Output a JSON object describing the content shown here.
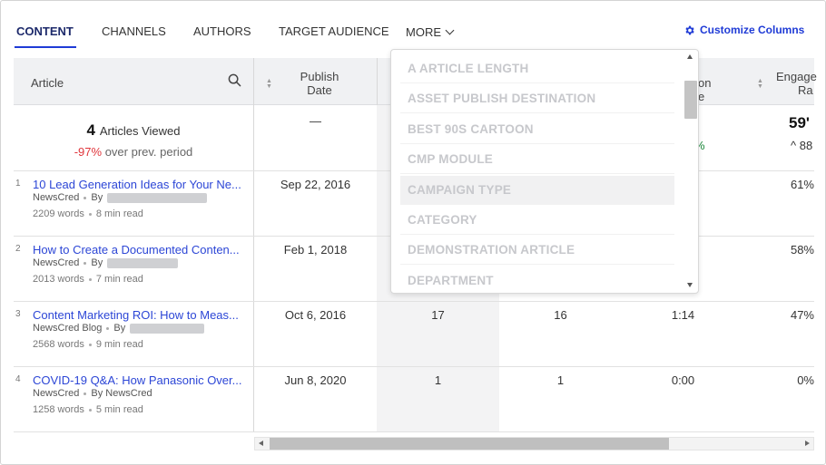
{
  "tabs": [
    {
      "label": "CONTENT"
    },
    {
      "label": "CHANNELS"
    },
    {
      "label": "AUTHORS"
    },
    {
      "label": "TARGET AUDIENCE"
    },
    {
      "label": "MORE"
    }
  ],
  "customize_label": "Customize Columns",
  "columns": {
    "article": "Article",
    "publish_line1": "Publish",
    "publish_line2": "Date",
    "duration_partial_1": "on",
    "duration_partial_2": "e",
    "engage_partial_1": "Engage",
    "engage_partial_2": "Ra"
  },
  "summary": {
    "count": "4",
    "label": "Articles Viewed",
    "change": "-97%",
    "change_suffix": "over prev. period",
    "publish_dash": "—",
    "duration_partial": "%",
    "engage_value": "59'",
    "engage_change": "^ 88"
  },
  "rows": [
    {
      "num": "1",
      "title": "10 Lead Generation Ideas for Your Ne...",
      "source": "NewsCred",
      "by": "By",
      "words": "2209 words",
      "read": "8 min read",
      "date": "Sep 22, 2016",
      "col3": "",
      "col4": "",
      "col5": "",
      "engage": "61%"
    },
    {
      "num": "2",
      "title": "How to Create a Documented Conten...",
      "source": "NewsCred",
      "by": "By",
      "words": "2013 words",
      "read": "7 min read",
      "date": "Feb 1, 2018",
      "col3": "",
      "col4": "",
      "col5": "",
      "engage": "58%"
    },
    {
      "num": "3",
      "title": "Content Marketing ROI: How to Meas...",
      "source": "NewsCred Blog",
      "by": "By",
      "words": "2568 words",
      "read": "9 min read",
      "date": "Oct 6, 2016",
      "col3": "17",
      "col4": "16",
      "col5": "1:14",
      "engage": "47%"
    },
    {
      "num": "4",
      "title": "COVID-19 Q&A: How Panasonic Over...",
      "source": "NewsCred",
      "by": "By NewsCred",
      "words": "1258 words",
      "read": "5 min read",
      "date": "Jun 8, 2020",
      "col3": "1",
      "col4": "1",
      "col5": "0:00",
      "engage": "0%"
    }
  ],
  "dropdown": {
    "items": [
      "A ARTICLE LENGTH",
      "ASSET PUBLISH DESTINATION",
      "BEST 90S CARTOON",
      "CMP MODULE",
      "CAMPAIGN TYPE",
      "CATEGORY",
      "DEMONSTRATION ARTICLE",
      "DEPARTMENT"
    ]
  },
  "colors": {
    "accent": "#1f3bd6",
    "link": "#2c46d6",
    "negative": "#e0363c",
    "positive": "#1c8a3c"
  }
}
